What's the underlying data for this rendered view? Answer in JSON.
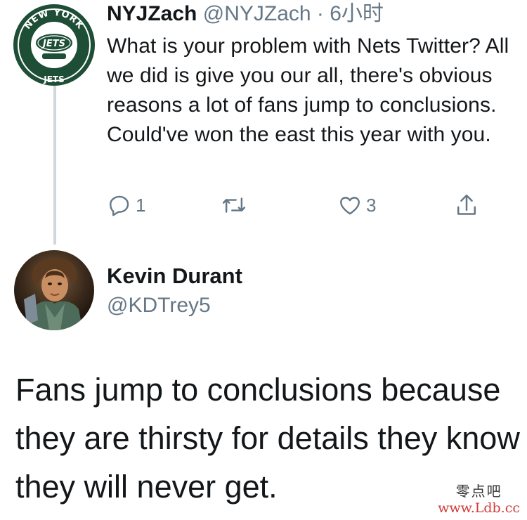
{
  "reply_to_tweet": {
    "display_name": "NYJZach",
    "handle": "@NYJZach",
    "separator": "·",
    "time": "6小时",
    "body": "What is your problem with Nets Twitter? All we did is give you our all, there's obvious reasons a lot of fans jump to conclusions. Could've won the east this year with you.",
    "actions": {
      "reply_count": "1",
      "like_count": "3"
    },
    "avatar_logo": {
      "top_text": "NEW YORK",
      "center_text": "JETS",
      "bottom_text": "JETS"
    }
  },
  "main_tweet": {
    "display_name": "Kevin Durant",
    "handle": "@KDTrey5",
    "body_lines": [
      "Fans jump to conclusions because",
      "they are thirsty for details they know",
      "they will never get."
    ]
  },
  "watermark": {
    "cn": "零点吧",
    "url": "www.Ldb.cc"
  },
  "colors": {
    "text_primary": "#14171a",
    "text_secondary": "#657786",
    "thread_line": "#cfd6dc",
    "jets_green": "#1f4e37",
    "watermark_red": "#d43a3a"
  },
  "icons": [
    "reply-icon",
    "retweet-icon",
    "like-icon",
    "share-icon"
  ]
}
